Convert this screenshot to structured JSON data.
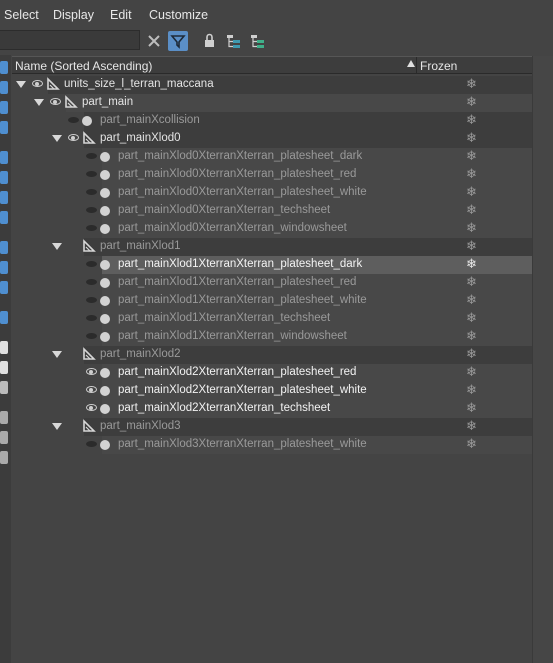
{
  "menu": [
    "Select",
    "Display",
    "Edit",
    "Customize"
  ],
  "toolbar": {
    "icons": [
      "clear-filter-icon",
      "filter-icon",
      "lock-icon",
      "hierarchy-icon",
      "layers-icon"
    ]
  },
  "header": {
    "name_col": "Name (Sorted Ascending)",
    "frozen_col": "Frozen"
  },
  "rows": [
    {
      "label": "units_size_l_terran_maccana",
      "depth": 0,
      "kind": "geo",
      "expand": true,
      "eye": "on",
      "style": "normal",
      "band": "dark"
    },
    {
      "label": "part_main",
      "depth": 1,
      "kind": "geo",
      "expand": true,
      "eye": "on",
      "style": "normal",
      "band": "mid"
    },
    {
      "label": "part_mainXcollision",
      "depth": 2,
      "kind": "dot",
      "expand": false,
      "eye": "off",
      "style": "dim",
      "band": "dark"
    },
    {
      "label": "part_mainXlod0",
      "depth": 2,
      "kind": "geo",
      "expand": true,
      "eye": "on",
      "style": "normal",
      "band": "dark"
    },
    {
      "label": "part_mainXlod0XterranXterran_platesheet_dark",
      "depth": 3,
      "kind": "dot",
      "expand": false,
      "eye": "off",
      "style": "dim",
      "band": "mid"
    },
    {
      "label": "part_mainXlod0XterranXterran_platesheet_red",
      "depth": 3,
      "kind": "dot",
      "expand": false,
      "eye": "off",
      "style": "dim",
      "band": "mid"
    },
    {
      "label": "part_mainXlod0XterranXterran_platesheet_white",
      "depth": 3,
      "kind": "dot",
      "expand": false,
      "eye": "off",
      "style": "dim",
      "band": "mid"
    },
    {
      "label": "part_mainXlod0XterranXterran_techsheet",
      "depth": 3,
      "kind": "dot",
      "expand": false,
      "eye": "off",
      "style": "dim",
      "band": "mid"
    },
    {
      "label": "part_mainXlod0XterranXterran_windowsheet",
      "depth": 3,
      "kind": "dot",
      "expand": false,
      "eye": "off",
      "style": "dim",
      "band": "mid"
    },
    {
      "label": "part_mainXlod1",
      "depth": 2,
      "kind": "geo",
      "expand": true,
      "eye": "none",
      "style": "dim",
      "band": "dark"
    },
    {
      "label": "part_mainXlod1XterranXterran_platesheet_dark",
      "depth": 3,
      "kind": "dot",
      "expand": false,
      "eye": "off",
      "style": "selected",
      "band": "sel"
    },
    {
      "label": "part_mainXlod1XterranXterran_platesheet_red",
      "depth": 3,
      "kind": "dot",
      "expand": false,
      "eye": "off",
      "style": "dim",
      "band": "mid"
    },
    {
      "label": "part_mainXlod1XterranXterran_platesheet_white",
      "depth": 3,
      "kind": "dot",
      "expand": false,
      "eye": "off",
      "style": "dim",
      "band": "mid"
    },
    {
      "label": "part_mainXlod1XterranXterran_techsheet",
      "depth": 3,
      "kind": "dot",
      "expand": false,
      "eye": "off",
      "style": "dim",
      "band": "mid"
    },
    {
      "label": "part_mainXlod1XterranXterran_windowsheet",
      "depth": 3,
      "kind": "dot",
      "expand": false,
      "eye": "off",
      "style": "dim",
      "band": "mid"
    },
    {
      "label": "part_mainXlod2",
      "depth": 2,
      "kind": "geo",
      "expand": true,
      "eye": "none",
      "style": "dim",
      "band": "dark"
    },
    {
      "label": "part_mainXlod2XterranXterran_platesheet_red",
      "depth": 3,
      "kind": "dot",
      "expand": false,
      "eye": "on",
      "style": "bright",
      "band": "mid"
    },
    {
      "label": "part_mainXlod2XterranXterran_platesheet_white",
      "depth": 3,
      "kind": "dot",
      "expand": false,
      "eye": "on",
      "style": "bright",
      "band": "mid"
    },
    {
      "label": "part_mainXlod2XterranXterran_techsheet",
      "depth": 3,
      "kind": "dot",
      "expand": false,
      "eye": "on",
      "style": "bright",
      "band": "mid"
    },
    {
      "label": "part_mainXlod3",
      "depth": 2,
      "kind": "geo",
      "expand": true,
      "eye": "none",
      "style": "dim",
      "band": "dark"
    },
    {
      "label": "part_mainXlod3XterranXterran_platesheet_white",
      "depth": 3,
      "kind": "dot",
      "expand": false,
      "eye": "off",
      "style": "dim",
      "band": "mid"
    }
  ],
  "frozen_icon": "snowflake-icon",
  "colors": {
    "bg": "#444444",
    "row_dark": "#3d3d3d",
    "row_mid": "#4a4a4a",
    "selected": "#5f5f5f",
    "accent": "#5b8fc7"
  }
}
